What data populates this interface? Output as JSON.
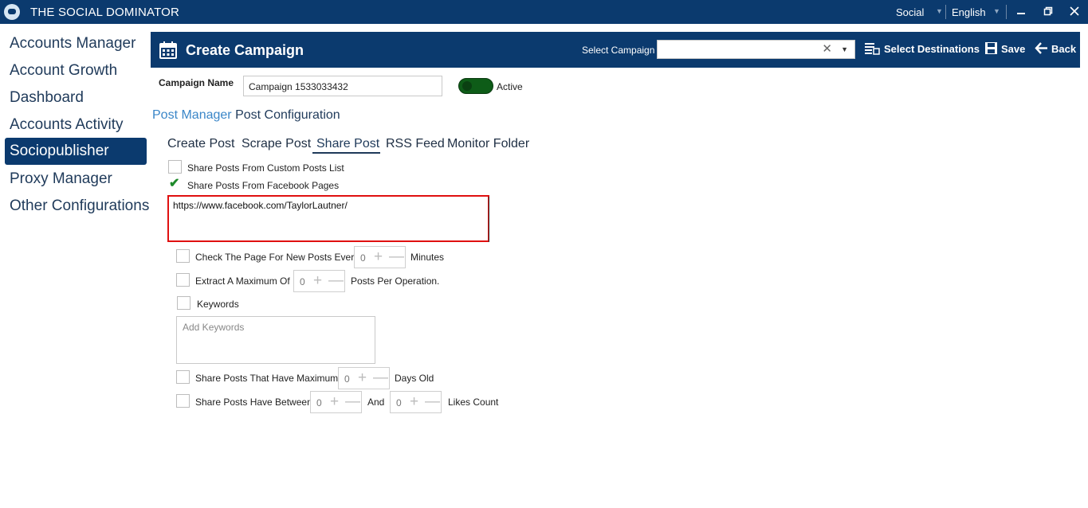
{
  "titlebar": {
    "app_title": "THE SOCIAL DOMINATOR",
    "network": "Social",
    "language": "English",
    "minimize_icon": "minimize-icon",
    "restore_icon": "restore-icon",
    "close_icon": "close-icon"
  },
  "sidebar": {
    "items": [
      {
        "label": "Accounts Manager"
      },
      {
        "label": "Account Growth"
      },
      {
        "label": "Dashboard"
      },
      {
        "label": "Accounts Activity"
      },
      {
        "label": "Sociopublisher",
        "active": true
      },
      {
        "label": "Proxy Manager"
      },
      {
        "label": "Other Configurations"
      }
    ]
  },
  "header": {
    "title": "Create Campaign",
    "select_campaign_label": "Select Campaign",
    "select_campaign_value": "",
    "select_destinations_label": "Select Destinations",
    "save_label": "Save",
    "back_label": "Back",
    "color": "#0b3a6e"
  },
  "campaign": {
    "name_label": "Campaign Name",
    "name_value": "Campaign 1533033432",
    "status_label": "Active",
    "active": true
  },
  "breadcrumb": {
    "link": "Post Manager",
    "current": "Post Configuration"
  },
  "tabs": [
    {
      "label": "Create Post"
    },
    {
      "label": "Scrape Post"
    },
    {
      "label": "Share Post",
      "active": true
    },
    {
      "label": "RSS Feed"
    },
    {
      "label": "Monitor Folder"
    }
  ],
  "options": {
    "custom_posts_label": "Share Posts From Custom Posts List",
    "custom_posts_checked": false,
    "facebook_pages_label": "Share Posts From Facebook Pages",
    "facebook_pages_checked": true,
    "facebook_pages_value": "https://www.facebook.com/TaylorLautner/",
    "check_page_label": "Check The Page For New Posts Every",
    "check_page_value": "0",
    "check_page_unit": "Minutes",
    "extract_max_label": "Extract A Maximum Of",
    "extract_max_value": "0",
    "extract_max_unit": "Posts Per Operation.",
    "keywords_label": "Keywords",
    "keywords_placeholder": "Add Keywords",
    "max_age_label": "Share Posts That Have Maximum",
    "max_age_value": "0",
    "max_age_unit": "Days Old",
    "likes_between_label": "Share Posts Have Between",
    "likes_min_value": "0",
    "likes_and": "And",
    "likes_max_value": "0",
    "likes_unit": "Likes Count"
  }
}
